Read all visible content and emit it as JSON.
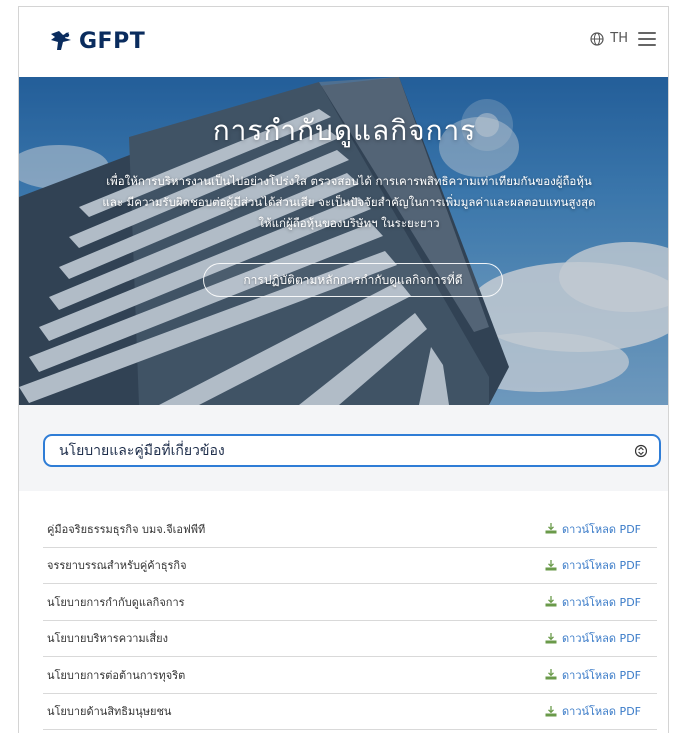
{
  "header": {
    "brand": "GFPT",
    "language": "TH"
  },
  "hero": {
    "title": "การกำกับดูแลกิจการ",
    "description_line1": "เพื่อให้การบริหารงานเป็นไปอย่างโปร่งใส ตรวจสอบได้ การเคารพสิทธิความเท่าเทียมกันของผู้ถือหุ้น",
    "description_line2": "และ มีความรับผิดชอบต่อผู้มีส่วนได้ส่วนเสีย จะเป็นปัจจัยสำคัญในการเพิ่มมูลค่าและผลตอบแทนสูงสุด",
    "description_line3": "ให้แก่ผู้ถือหุ้นของบริษัทฯ ในระยะยาว",
    "button_label": "การปฏิบัติตามหลักการกำกับดูแลกิจการที่ดี"
  },
  "select": {
    "value": "นโยบายและคู่มือที่เกี่ยวข้อง"
  },
  "documents": [
    {
      "name": "คู่มือจริยธรรมธุรกิจ บมจ.จีเอฟพีที",
      "action": "ดาวน์โหลด PDF"
    },
    {
      "name": "จรรยาบรรณสำหรับคู่ค้าธุรกิจ",
      "action": "ดาวน์โหลด PDF"
    },
    {
      "name": "นโยบายการกำกับดูแลกิจการ",
      "action": "ดาวน์โหลด PDF"
    },
    {
      "name": "นโยบายบริหารความเสี่ยง",
      "action": "ดาวน์โหลด PDF"
    },
    {
      "name": "นโยบายการต่อต้านการทุจริต",
      "action": "ดาวน์โหลด PDF"
    },
    {
      "name": "นโยบายด้านสิทธิมนุษยชน",
      "action": "ดาวน์โหลด PDF"
    }
  ],
  "colors": {
    "brand": "#0a2c5e",
    "accent": "#2f7dd6",
    "link": "#3a7bc8",
    "band": "#f4f5f7"
  },
  "icons": [
    "gfpt-logo-icon",
    "globe-icon",
    "hamburger-menu-icon",
    "chevron-updown-icon",
    "download-icon"
  ]
}
